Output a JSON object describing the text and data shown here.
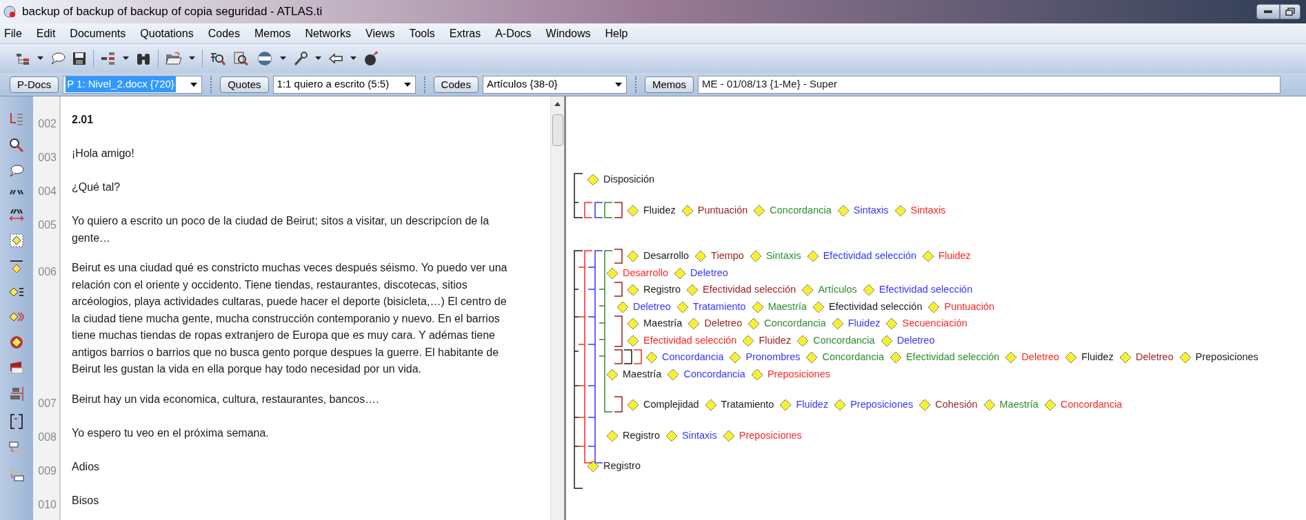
{
  "window": {
    "title": "backup of backup of backup of copia seguridad - ATLAS.ti"
  },
  "menu": [
    "File",
    "Edit",
    "Documents",
    "Quotations",
    "Codes",
    "Memos",
    "Networks",
    "Views",
    "Tools",
    "Extras",
    "A-Docs",
    "Windows",
    "Help"
  ],
  "selectors": [
    {
      "button": "P-Docs",
      "value": "P 1: Nivel_2.docx {720}",
      "selected": true,
      "kind": "combo"
    },
    {
      "button": "Quotes",
      "value": "1:1 quiero a escrito (5:5)",
      "selected": false,
      "kind": "combo"
    },
    {
      "button": "Codes",
      "value": "Artículos {38-0}",
      "selected": false,
      "kind": "combo"
    },
    {
      "button": "Memos",
      "value": "ME - 01/08/13 {1-Me} - Super",
      "kind": "field"
    }
  ],
  "document": {
    "paragraphs": [
      {
        "line": "002",
        "text": "2.01",
        "bold": true
      },
      {
        "line": "003",
        "text": "¡Hola amigo!",
        "bold": false
      },
      {
        "line": "004",
        "text": "¿Qué tal?",
        "bold": false
      },
      {
        "line": "005",
        "text": "Yo quiero a escrito un poco de la ciudad de Beirut; sitos a visitar, un descripcíon de la gente…",
        "bold": false
      },
      {
        "line": "006",
        "text": "Beirut es una ciudad qué es constricto muchas veces después séismo. Yo puedo ver una relación con el oriente y occidento. Tiene tiendas, restaurantes, discotecas, sitios arcéologios, playa actividades cultaras, puede hacer el deporte (bisicleta,…) El centro de la ciudad tiene mucha gente, mucha construcción contemporanio y nuevo. En el barrios tiene muchas tiendas de ropas extranjero de Europa que es muy cara. Y adémas tiene antigos barrios o barrios que no busca gento porque despues la guerre. El habitante de Beirut les gustan la vida en ella porque hay todo necesidad por un vida.",
        "bold": false
      },
      {
        "line": "007",
        "text": "Beirut hay un vida economica, cultura, restaurantes, bancos….",
        "bold": false
      },
      {
        "line": "008",
        "text": "Yo espero tu veo en el próxima semana.",
        "bold": false
      },
      {
        "line": "009",
        "text": "Adios",
        "bold": false
      },
      {
        "line": "010",
        "text": "Bisos",
        "bold": false
      }
    ]
  },
  "margin_codes": [
    [
      {
        "name": "Disposición",
        "color": "#1a1a1a"
      }
    ],
    [
      {
        "name": "Fluidez",
        "color": "#1a1a1a"
      },
      {
        "name": "Puntuación",
        "color": "#9b1c1c"
      },
      {
        "name": "Concordancia",
        "color": "#2e8b2e"
      },
      {
        "name": "Sintaxis",
        "color": "#3535ff"
      },
      {
        "name": "Sintaxis",
        "color": "#ff2424"
      }
    ],
    [
      {
        "name": "Desarrollo",
        "color": "#1a1a1a"
      },
      {
        "name": "Tiempo",
        "color": "#9b1c1c"
      },
      {
        "name": "Sintaxis",
        "color": "#2e8b2e"
      },
      {
        "name": "Efectividad selección",
        "color": "#3535ff"
      },
      {
        "name": "Fluidez",
        "color": "#ff2424"
      }
    ],
    [
      {
        "name": "Desarrollo",
        "color": "#ff2424"
      },
      {
        "name": "Deletreo",
        "color": "#3535ff"
      }
    ],
    [
      {
        "name": "Registro",
        "color": "#1a1a1a"
      },
      {
        "name": "Efectividad selección",
        "color": "#9b1c1c"
      },
      {
        "name": "Artículos",
        "color": "#2e8b2e"
      },
      {
        "name": "Efectividad selección",
        "color": "#3535ff"
      }
    ],
    [
      {
        "name": "Deletreo",
        "color": "#3535ff"
      },
      {
        "name": "Tratamiento",
        "color": "#3535ff"
      },
      {
        "name": "Maestría",
        "color": "#2e8b2e"
      },
      {
        "name": "Efectividad selección",
        "color": "#1a1a1a"
      },
      {
        "name": "Puntuación",
        "color": "#ff2424"
      }
    ],
    [
      {
        "name": "Maestría",
        "color": "#1a1a1a"
      },
      {
        "name": "Deletreo",
        "color": "#9b1c1c"
      },
      {
        "name": "Concordancia",
        "color": "#2e8b2e"
      },
      {
        "name": "Fluidez",
        "color": "#3535ff"
      },
      {
        "name": "Secuenciación",
        "color": "#ff2424"
      }
    ],
    [
      {
        "name": "Efectividad selección",
        "color": "#ff2424"
      },
      {
        "name": "Fluidez",
        "color": "#9b1c1c"
      },
      {
        "name": "Concordancia",
        "color": "#2e8b2e"
      },
      {
        "name": "Deletreo",
        "color": "#3535ff"
      }
    ],
    [
      {
        "name": "Concordancia",
        "color": "#3535ff"
      },
      {
        "name": "Pronombres",
        "color": "#3535ff"
      },
      {
        "name": "Concordancia",
        "color": "#2e8b2e"
      },
      {
        "name": "Efectividad selección",
        "color": "#2e8b2e"
      },
      {
        "name": "Deletreo",
        "color": "#ff2424"
      },
      {
        "name": "Fluidez",
        "color": "#1a1a1a"
      },
      {
        "name": "Deletreo",
        "color": "#9b1c1c"
      },
      {
        "name": "Preposiciones",
        "color": "#1a1a1a"
      }
    ],
    [
      {
        "name": "Maestría",
        "color": "#1a1a1a"
      },
      {
        "name": "Concordancia",
        "color": "#3535ff"
      },
      {
        "name": "Preposiciones",
        "color": "#ff2424"
      }
    ],
    [
      {
        "name": "Complejidad",
        "color": "#1a1a1a"
      },
      {
        "name": "Tratamiento",
        "color": "#1a1a1a"
      },
      {
        "name": "Fluidez",
        "color": "#3535ff"
      },
      {
        "name": "Preposiciones",
        "color": "#3535ff"
      },
      {
        "name": "Cohesión",
        "color": "#9b1c1c"
      },
      {
        "name": "Maestría",
        "color": "#2e8b2e"
      },
      {
        "name": "Concordancia",
        "color": "#ff2424"
      }
    ],
    [
      {
        "name": "Registro",
        "color": "#1a1a1a"
      },
      {
        "name": "Sintaxis",
        "color": "#3535ff"
      },
      {
        "name": "Preposiciones",
        "color": "#ff2424"
      }
    ],
    [
      {
        "name": "Registro",
        "color": "#1a1a1a"
      }
    ]
  ]
}
